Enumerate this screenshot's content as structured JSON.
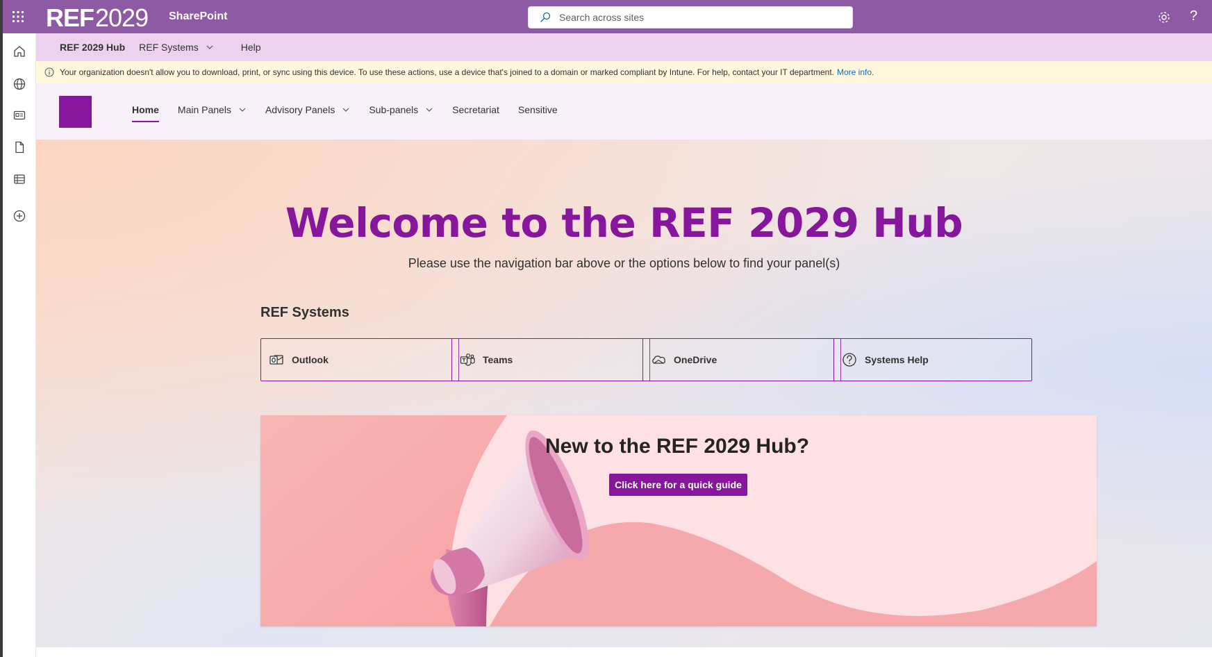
{
  "topbar": {
    "brand_ref": "REF",
    "brand_year": "2029",
    "app_name": "SharePoint",
    "search_placeholder": "Search across sites",
    "help_glyph": "?",
    "color": "#8e5aa4"
  },
  "rail": {
    "icons": [
      "home-icon",
      "globe-icon",
      "news-icon",
      "document-icon",
      "list-icon",
      "add-icon"
    ]
  },
  "hub_nav": {
    "title": "REF 2029 Hub",
    "items": [
      {
        "label": "REF Systems",
        "has_dropdown": true
      },
      {
        "label": "Help",
        "has_dropdown": false
      }
    ]
  },
  "notice": {
    "text": "Your organization doesn't allow you to download, print, or sync using this device. To use these actions, use a device that's joined to a domain or marked compliant by Intune. For help, contact your IT department.",
    "link": "More info."
  },
  "site_nav": {
    "items": [
      {
        "label": "Home",
        "active": true
      },
      {
        "label": "Main Panels",
        "has_dropdown": true
      },
      {
        "label": "Advisory Panels",
        "has_dropdown": true
      },
      {
        "label": "Sub-panels",
        "has_dropdown": true
      },
      {
        "label": "Secretariat"
      },
      {
        "label": "Sensitive"
      }
    ]
  },
  "hero": {
    "title": "Welcome to the REF 2029 Hub",
    "subtitle": "Please use the navigation bar above or the options below to find your panel(s)"
  },
  "systems": {
    "heading": "REF Systems",
    "buttons": [
      {
        "label": "Outlook",
        "icon": "outlook-icon"
      },
      {
        "label": "Teams",
        "icon": "teams-icon"
      },
      {
        "label": "OneDrive",
        "icon": "onedrive-icon"
      },
      {
        "label": "Systems Help",
        "icon": "help-circle-icon"
      }
    ]
  },
  "banner": {
    "title": "New to the REF 2029 Hub?",
    "button": "Click here for a quick guide",
    "image": "megaphone-illustration"
  },
  "colors": {
    "accent": "#86179c",
    "hub_nav_bg": "#ecd2ee",
    "notice_bg": "#fff8dc",
    "banner_bg": "#fde1e4"
  }
}
